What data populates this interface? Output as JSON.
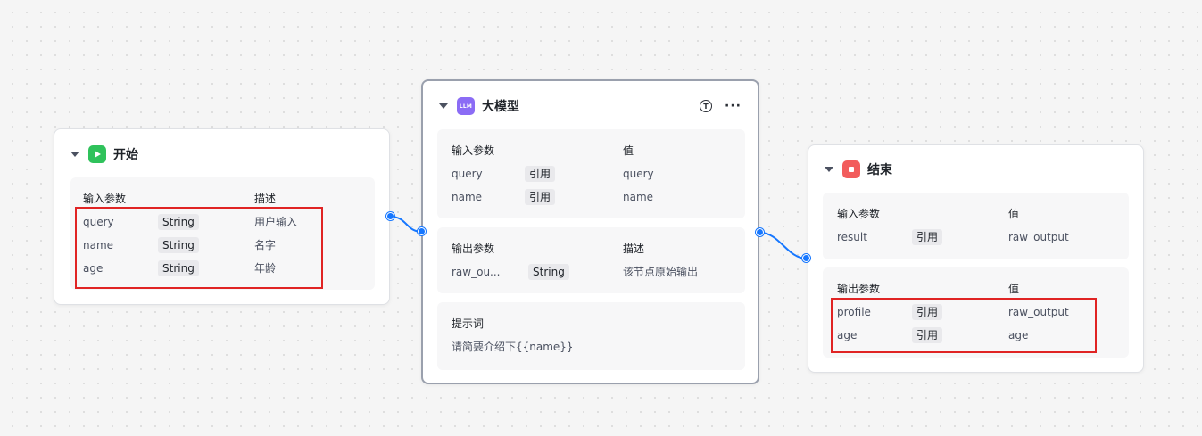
{
  "colors": {
    "accent": "#1677ff",
    "start_icon": "#2fc25b",
    "llm_icon": "#8b6cf5",
    "end_icon": "#f25c5c",
    "highlight": "#e02424"
  },
  "start_node": {
    "title": "开始",
    "icon": "play-icon",
    "inputs": {
      "col_name": "输入参数",
      "col_desc": "描述",
      "rows": [
        {
          "name": "query",
          "type": "String",
          "desc": "用户输入"
        },
        {
          "name": "name",
          "type": "String",
          "desc": "名字"
        },
        {
          "name": "age",
          "type": "String",
          "desc": "年龄"
        }
      ]
    }
  },
  "llm_node": {
    "title": "大模型",
    "icon_label": "LLM",
    "action_t": "T",
    "action_more": "···",
    "inputs": {
      "col_name": "输入参数",
      "col_value": "值",
      "rows": [
        {
          "name": "query",
          "mode": "引用",
          "value": "query"
        },
        {
          "name": "name",
          "mode": "引用",
          "value": "name"
        }
      ]
    },
    "outputs": {
      "col_name": "输出参数",
      "col_desc": "描述",
      "rows": [
        {
          "name": "raw_ou...",
          "type": "String",
          "desc": "该节点原始输出"
        }
      ]
    },
    "prompt": {
      "label": "提示词",
      "text": "请简要介绍下{{name}}"
    }
  },
  "end_node": {
    "title": "结束",
    "icon": "stop-icon",
    "inputs": {
      "col_name": "输入参数",
      "col_value": "值",
      "rows": [
        {
          "name": "result",
          "mode": "引用",
          "value": "raw_output"
        }
      ]
    },
    "outputs": {
      "col_name": "输出参数",
      "col_value": "值",
      "rows": [
        {
          "name": "profile",
          "mode": "引用",
          "value": "raw_output"
        },
        {
          "name": "age",
          "mode": "引用",
          "value": "age"
        }
      ]
    }
  }
}
